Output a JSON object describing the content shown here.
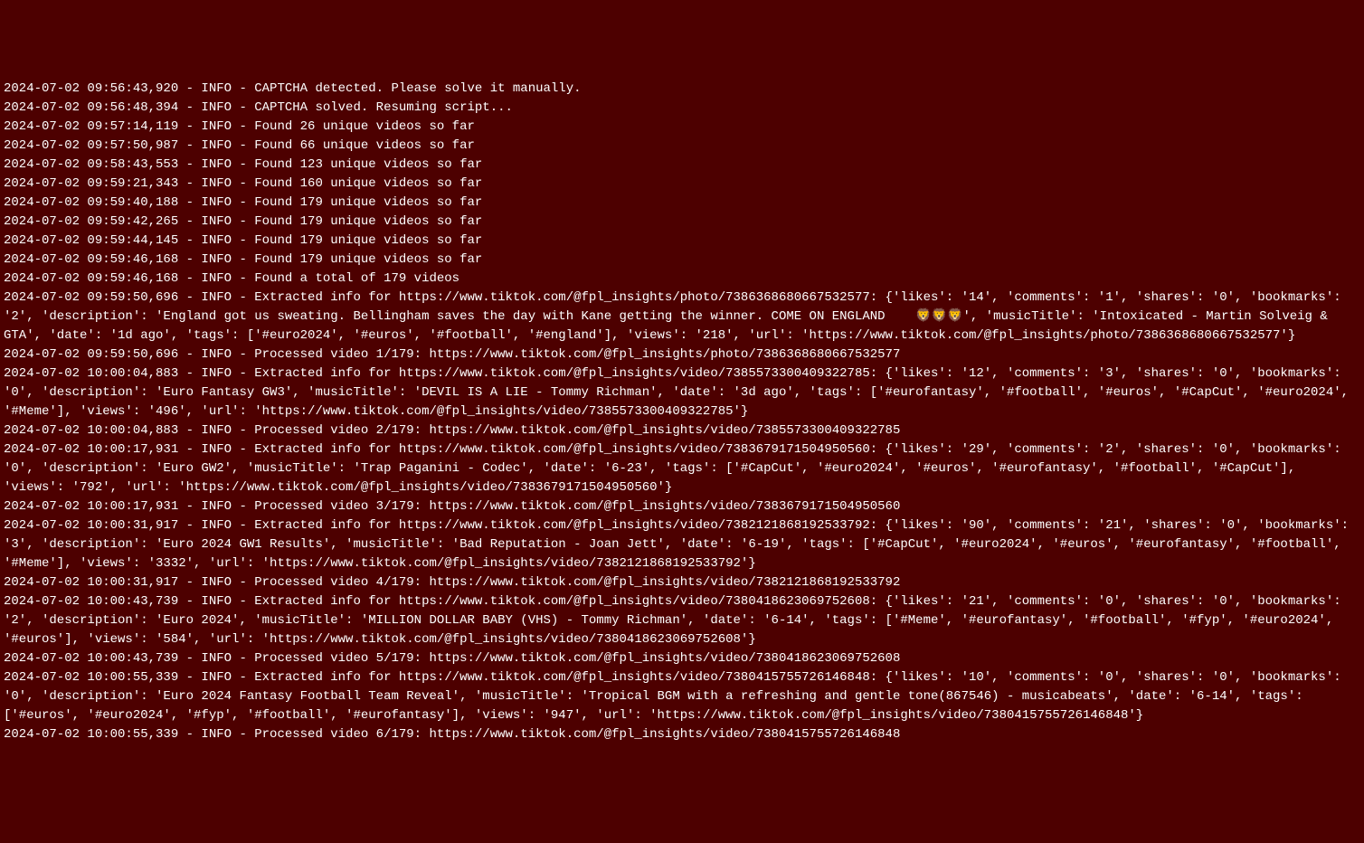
{
  "log_lines": [
    "2024-07-02 09:56:43,920 - INFO - CAPTCHA detected. Please solve it manually.",
    "2024-07-02 09:56:48,394 - INFO - CAPTCHA solved. Resuming script...",
    "2024-07-02 09:57:14,119 - INFO - Found 26 unique videos so far",
    "2024-07-02 09:57:50,987 - INFO - Found 66 unique videos so far",
    "2024-07-02 09:58:43,553 - INFO - Found 123 unique videos so far",
    "2024-07-02 09:59:21,343 - INFO - Found 160 unique videos so far",
    "2024-07-02 09:59:40,188 - INFO - Found 179 unique videos so far",
    "2024-07-02 09:59:42,265 - INFO - Found 179 unique videos so far",
    "2024-07-02 09:59:44,145 - INFO - Found 179 unique videos so far",
    "2024-07-02 09:59:46,168 - INFO - Found 179 unique videos so far",
    "2024-07-02 09:59:46,168 - INFO - Found a total of 179 videos",
    "2024-07-02 09:59:50,696 - INFO - Extracted info for https://www.tiktok.com/@fpl_insights/photo/7386368680667532577: {'likes': '14', 'comments': '1', 'shares': '0', 'bookmarks': '2', 'description': 'England got us sweating. Bellingham saves the day with Kane getting the winner. COME ON ENGLAND    🦁🦁🦁', 'musicTitle': 'Intoxicated - Martin Solveig & GTA', 'date': '1d ago', 'tags': ['#euro2024', '#euros', '#football', '#england'], 'views': '218', 'url': 'https://www.tiktok.com/@fpl_insights/photo/7386368680667532577'}",
    "2024-07-02 09:59:50,696 - INFO - Processed video 1/179: https://www.tiktok.com/@fpl_insights/photo/7386368680667532577",
    "2024-07-02 10:00:04,883 - INFO - Extracted info for https://www.tiktok.com/@fpl_insights/video/7385573300409322785: {'likes': '12', 'comments': '3', 'shares': '0', 'bookmarks': '0', 'description': 'Euro Fantasy GW3', 'musicTitle': 'DEVIL IS A LIE - Tommy Richman', 'date': '3d ago', 'tags': ['#eurofantasy', '#football', '#euros', '#CapCut', '#euro2024', '#Meme'], 'views': '496', 'url': 'https://www.tiktok.com/@fpl_insights/video/7385573300409322785'}",
    "2024-07-02 10:00:04,883 - INFO - Processed video 2/179: https://www.tiktok.com/@fpl_insights/video/7385573300409322785",
    "2024-07-02 10:00:17,931 - INFO - Extracted info for https://www.tiktok.com/@fpl_insights/video/7383679171504950560: {'likes': '29', 'comments': '2', 'shares': '0', 'bookmarks': '0', 'description': 'Euro GW2', 'musicTitle': 'Trap Paganini - Codec', 'date': '6-23', 'tags': ['#CapCut', '#euro2024', '#euros', '#eurofantasy', '#football', '#CapCut'], 'views': '792', 'url': 'https://www.tiktok.com/@fpl_insights/video/7383679171504950560'}",
    "2024-07-02 10:00:17,931 - INFO - Processed video 3/179: https://www.tiktok.com/@fpl_insights/video/7383679171504950560",
    "2024-07-02 10:00:31,917 - INFO - Extracted info for https://www.tiktok.com/@fpl_insights/video/7382121868192533792: {'likes': '90', 'comments': '21', 'shares': '0', 'bookmarks': '3', 'description': 'Euro 2024 GW1 Results', 'musicTitle': 'Bad Reputation - Joan Jett', 'date': '6-19', 'tags': ['#CapCut', '#euro2024', '#euros', '#eurofantasy', '#football', '#Meme'], 'views': '3332', 'url': 'https://www.tiktok.com/@fpl_insights/video/7382121868192533792'}",
    "2024-07-02 10:00:31,917 - INFO - Processed video 4/179: https://www.tiktok.com/@fpl_insights/video/7382121868192533792",
    "2024-07-02 10:00:43,739 - INFO - Extracted info for https://www.tiktok.com/@fpl_insights/video/7380418623069752608: {'likes': '21', 'comments': '0', 'shares': '0', 'bookmarks': '2', 'description': 'Euro 2024', 'musicTitle': 'MILLION DOLLAR BABY (VHS) - Tommy Richman', 'date': '6-14', 'tags': ['#Meme', '#eurofantasy', '#football', '#fyp', '#euro2024', '#euros'], 'views': '584', 'url': 'https://www.tiktok.com/@fpl_insights/video/7380418623069752608'}",
    "2024-07-02 10:00:43,739 - INFO - Processed video 5/179: https://www.tiktok.com/@fpl_insights/video/7380418623069752608",
    "2024-07-02 10:00:55,339 - INFO - Extracted info for https://www.tiktok.com/@fpl_insights/video/7380415755726146848: {'likes': '10', 'comments': '0', 'shares': '0', 'bookmarks': '0', 'description': 'Euro 2024 Fantasy Football Team Reveal', 'musicTitle': 'Tropical BGM with a refreshing and gentle tone(867546) - musicabeats', 'date': '6-14', 'tags': ['#euros', '#euro2024', '#fyp', '#football', '#eurofantasy'], 'views': '947', 'url': 'https://www.tiktok.com/@fpl_insights/video/7380415755726146848'}",
    "2024-07-02 10:00:55,339 - INFO - Processed video 6/179: https://www.tiktok.com/@fpl_insights/video/7380415755726146848"
  ]
}
